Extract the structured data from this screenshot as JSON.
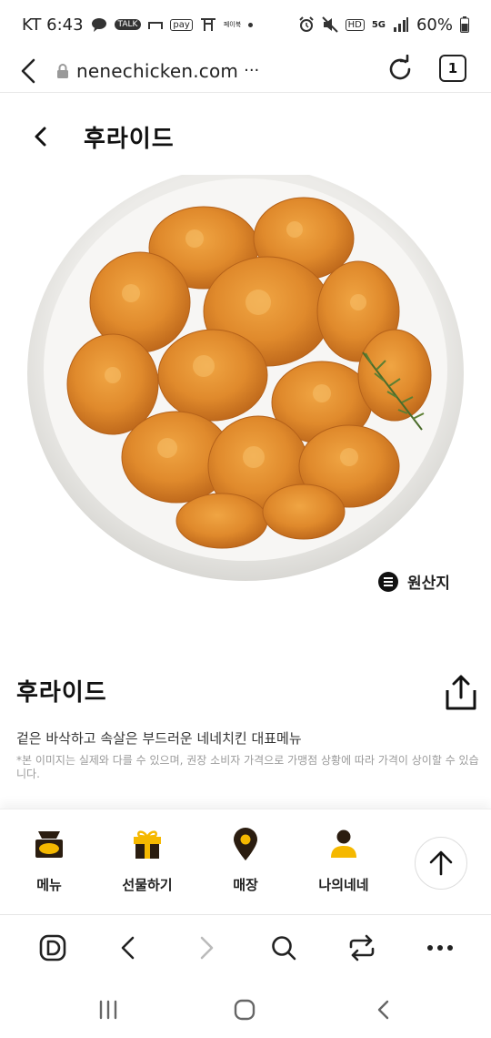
{
  "status_bar": {
    "carrier_time": "KT 6:43",
    "icons_left": [
      "chat-bubble-icon",
      "talk-icon",
      "cast-icon",
      "pay-icon",
      "t-icon",
      "app-icon",
      "dot-icon"
    ],
    "talk_label": "TALK",
    "pay_label": "pay",
    "app_label": "페이북",
    "icons_right": [
      "alarm-icon",
      "mute-icon",
      "hd-icon",
      "5g-icon",
      "signal-icon",
      "battery-icon"
    ],
    "hd_label": "HD",
    "network_label": "5G",
    "battery": "60%"
  },
  "browser": {
    "url": "nenechicken.com",
    "url_more": "···",
    "tab_count": "1"
  },
  "header": {
    "title": "후라이드"
  },
  "origin": {
    "label": "원산지"
  },
  "product": {
    "name": "후라이드",
    "description": "겉은 바삭하고 속살은 부드러운 네네치킨 대표메뉴",
    "note": "*본 이미지는 실제와 다를 수 있으며, 권장 소비자 가격으로 가맹점 상황에 따라 가격이 상이할 수 있습니다."
  },
  "site_nav": {
    "items": [
      {
        "label": "메뉴",
        "icon": "menu-box-icon"
      },
      {
        "label": "선물하기",
        "icon": "gift-icon"
      },
      {
        "label": "매장",
        "icon": "location-pin-icon"
      },
      {
        "label": "나의네네",
        "icon": "user-icon"
      }
    ],
    "scroll_top_icon": "arrow-up-icon"
  },
  "browser_toolbar": {
    "icons": [
      "home-d-icon",
      "back-icon",
      "forward-icon",
      "search-icon",
      "switch-icon",
      "more-icon"
    ]
  },
  "android_nav": {
    "icons": [
      "recent-apps-icon",
      "home-icon",
      "back-icon"
    ]
  },
  "colors": {
    "accent": "#f5b800",
    "dark": "#2b1d10",
    "text": "#111111"
  }
}
